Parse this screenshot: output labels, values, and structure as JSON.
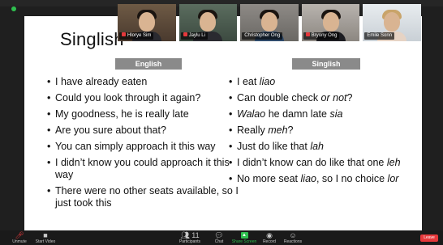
{
  "slide": {
    "title": "Singlish",
    "english_header": "English",
    "singlish_header": "Singlish",
    "english_lines": [
      "I have already eaten",
      "Could you look through it again?",
      "My goodness, he is really late",
      "Are you sure about that?",
      "You can simply approach it this way",
      "I didn’t know you could approach it this way",
      "There were no other seats available, so I just took this"
    ],
    "singlish_lines": [
      {
        "pre": "I eat ",
        "em": "liao",
        "post": ""
      },
      {
        "pre": "Can double check ",
        "em": "or not",
        "post": "?"
      },
      {
        "pre": "",
        "em": "Walao",
        "post": " he damn late ",
        "em2": "sia"
      },
      {
        "pre": "Really ",
        "em": "meh",
        "post": "?"
      },
      {
        "pre": "Just do like that ",
        "em": "lah",
        "post": ""
      },
      {
        "pre": "I didn’t know can do like that one ",
        "em": "leh",
        "post": ""
      },
      {
        "pre": "No more seat ",
        "em": "liao",
        "post": ", so I no choice ",
        "em2": "lor"
      }
    ]
  },
  "participants": [
    {
      "name": "Hlorye Sim",
      "muted": true
    },
    {
      "name": "Jaylu Li",
      "muted": true
    },
    {
      "name": "Christopher Ong",
      "muted": false
    },
    {
      "name": "Bryony Ong",
      "muted": true
    },
    {
      "name": "Emile Sonn",
      "muted": false
    }
  ],
  "toolbar": {
    "unmute": "Unmute",
    "start_video": "Start Video",
    "participants": "Participants",
    "participants_count": "11",
    "chat": "Chat",
    "share_screen": "Share Screen",
    "record": "Record",
    "reactions": "Reactions",
    "leave": "Leave"
  },
  "colors": {
    "header_gray": "#8a8a8a",
    "share_green": "#2fbf4f",
    "leave_red": "#e5383b"
  }
}
